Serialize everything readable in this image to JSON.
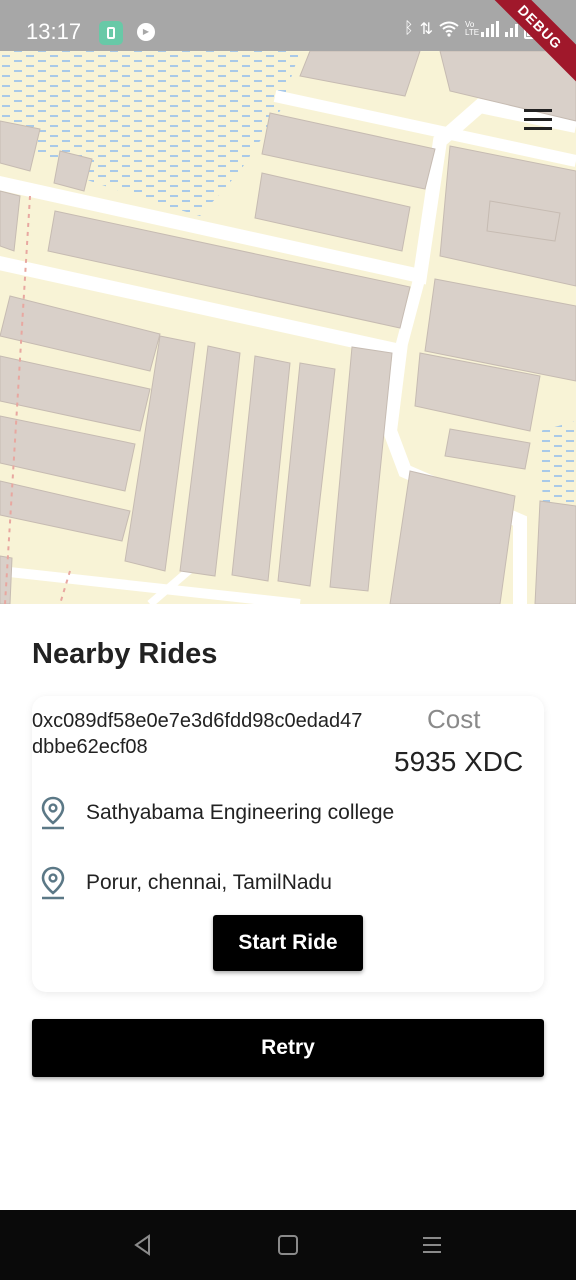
{
  "status_bar": {
    "time": "13:17",
    "icons": [
      "app-notification-icon",
      "camera-icon",
      "bluetooth-icon",
      "data-arrows-icon",
      "wifi-icon",
      "volte-icon",
      "signal-icon",
      "battery-icon"
    ],
    "volte_label": "Vo LTE"
  },
  "debug_banner": "DEBUG",
  "map": {
    "colors": {
      "land": "#f8f3d6",
      "building": "#d9d0c9",
      "road": "#ffffff",
      "water_dash": "#a9c9e8"
    }
  },
  "nearby": {
    "title": "Nearby Rides",
    "ride": {
      "id": "0xc089df58e0e7e3d6fdd98c0edad47dbbe62ecf08",
      "cost_label": "Cost",
      "cost_value": "5935 XDC",
      "pickup": "Sathyabama Engineering college",
      "dropoff": "Porur, chennai, TamilNadu",
      "start_label": "Start Ride"
    },
    "retry_label": "Retry"
  },
  "nav_bar": {
    "icons": [
      "back-icon",
      "home-icon",
      "recents-icon"
    ]
  }
}
